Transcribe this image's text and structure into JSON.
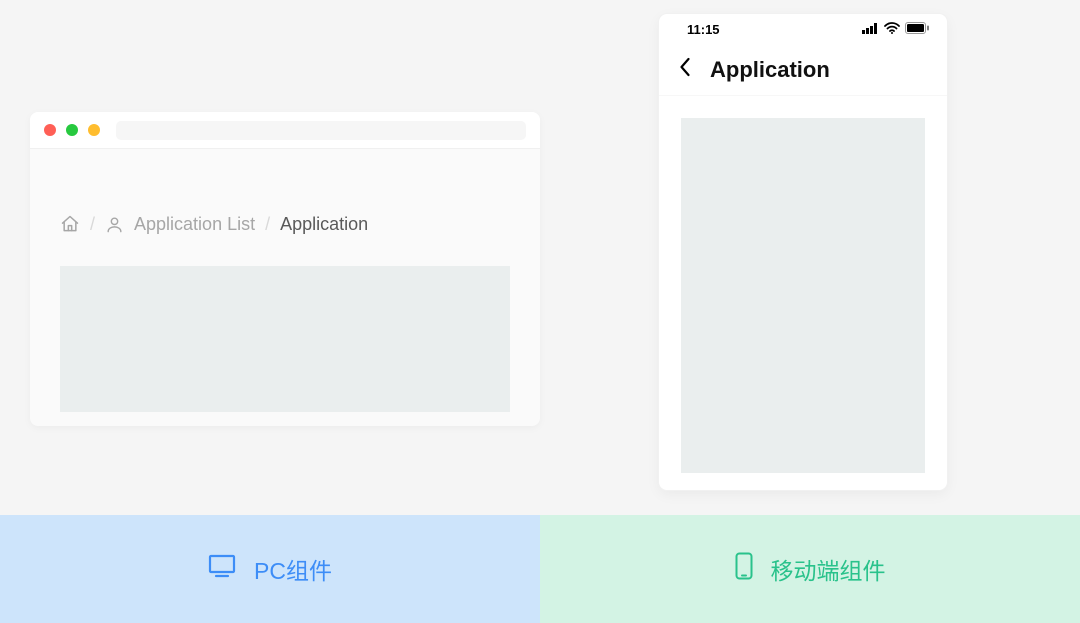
{
  "browser": {
    "breadcrumb": {
      "list_label": "Application List",
      "current_label": "Application",
      "separator": "/"
    }
  },
  "phone": {
    "status": {
      "time": "11:15"
    },
    "header": {
      "title": "Application"
    }
  },
  "labels": {
    "pc": "PC组件",
    "mobile": "移动端组件"
  }
}
